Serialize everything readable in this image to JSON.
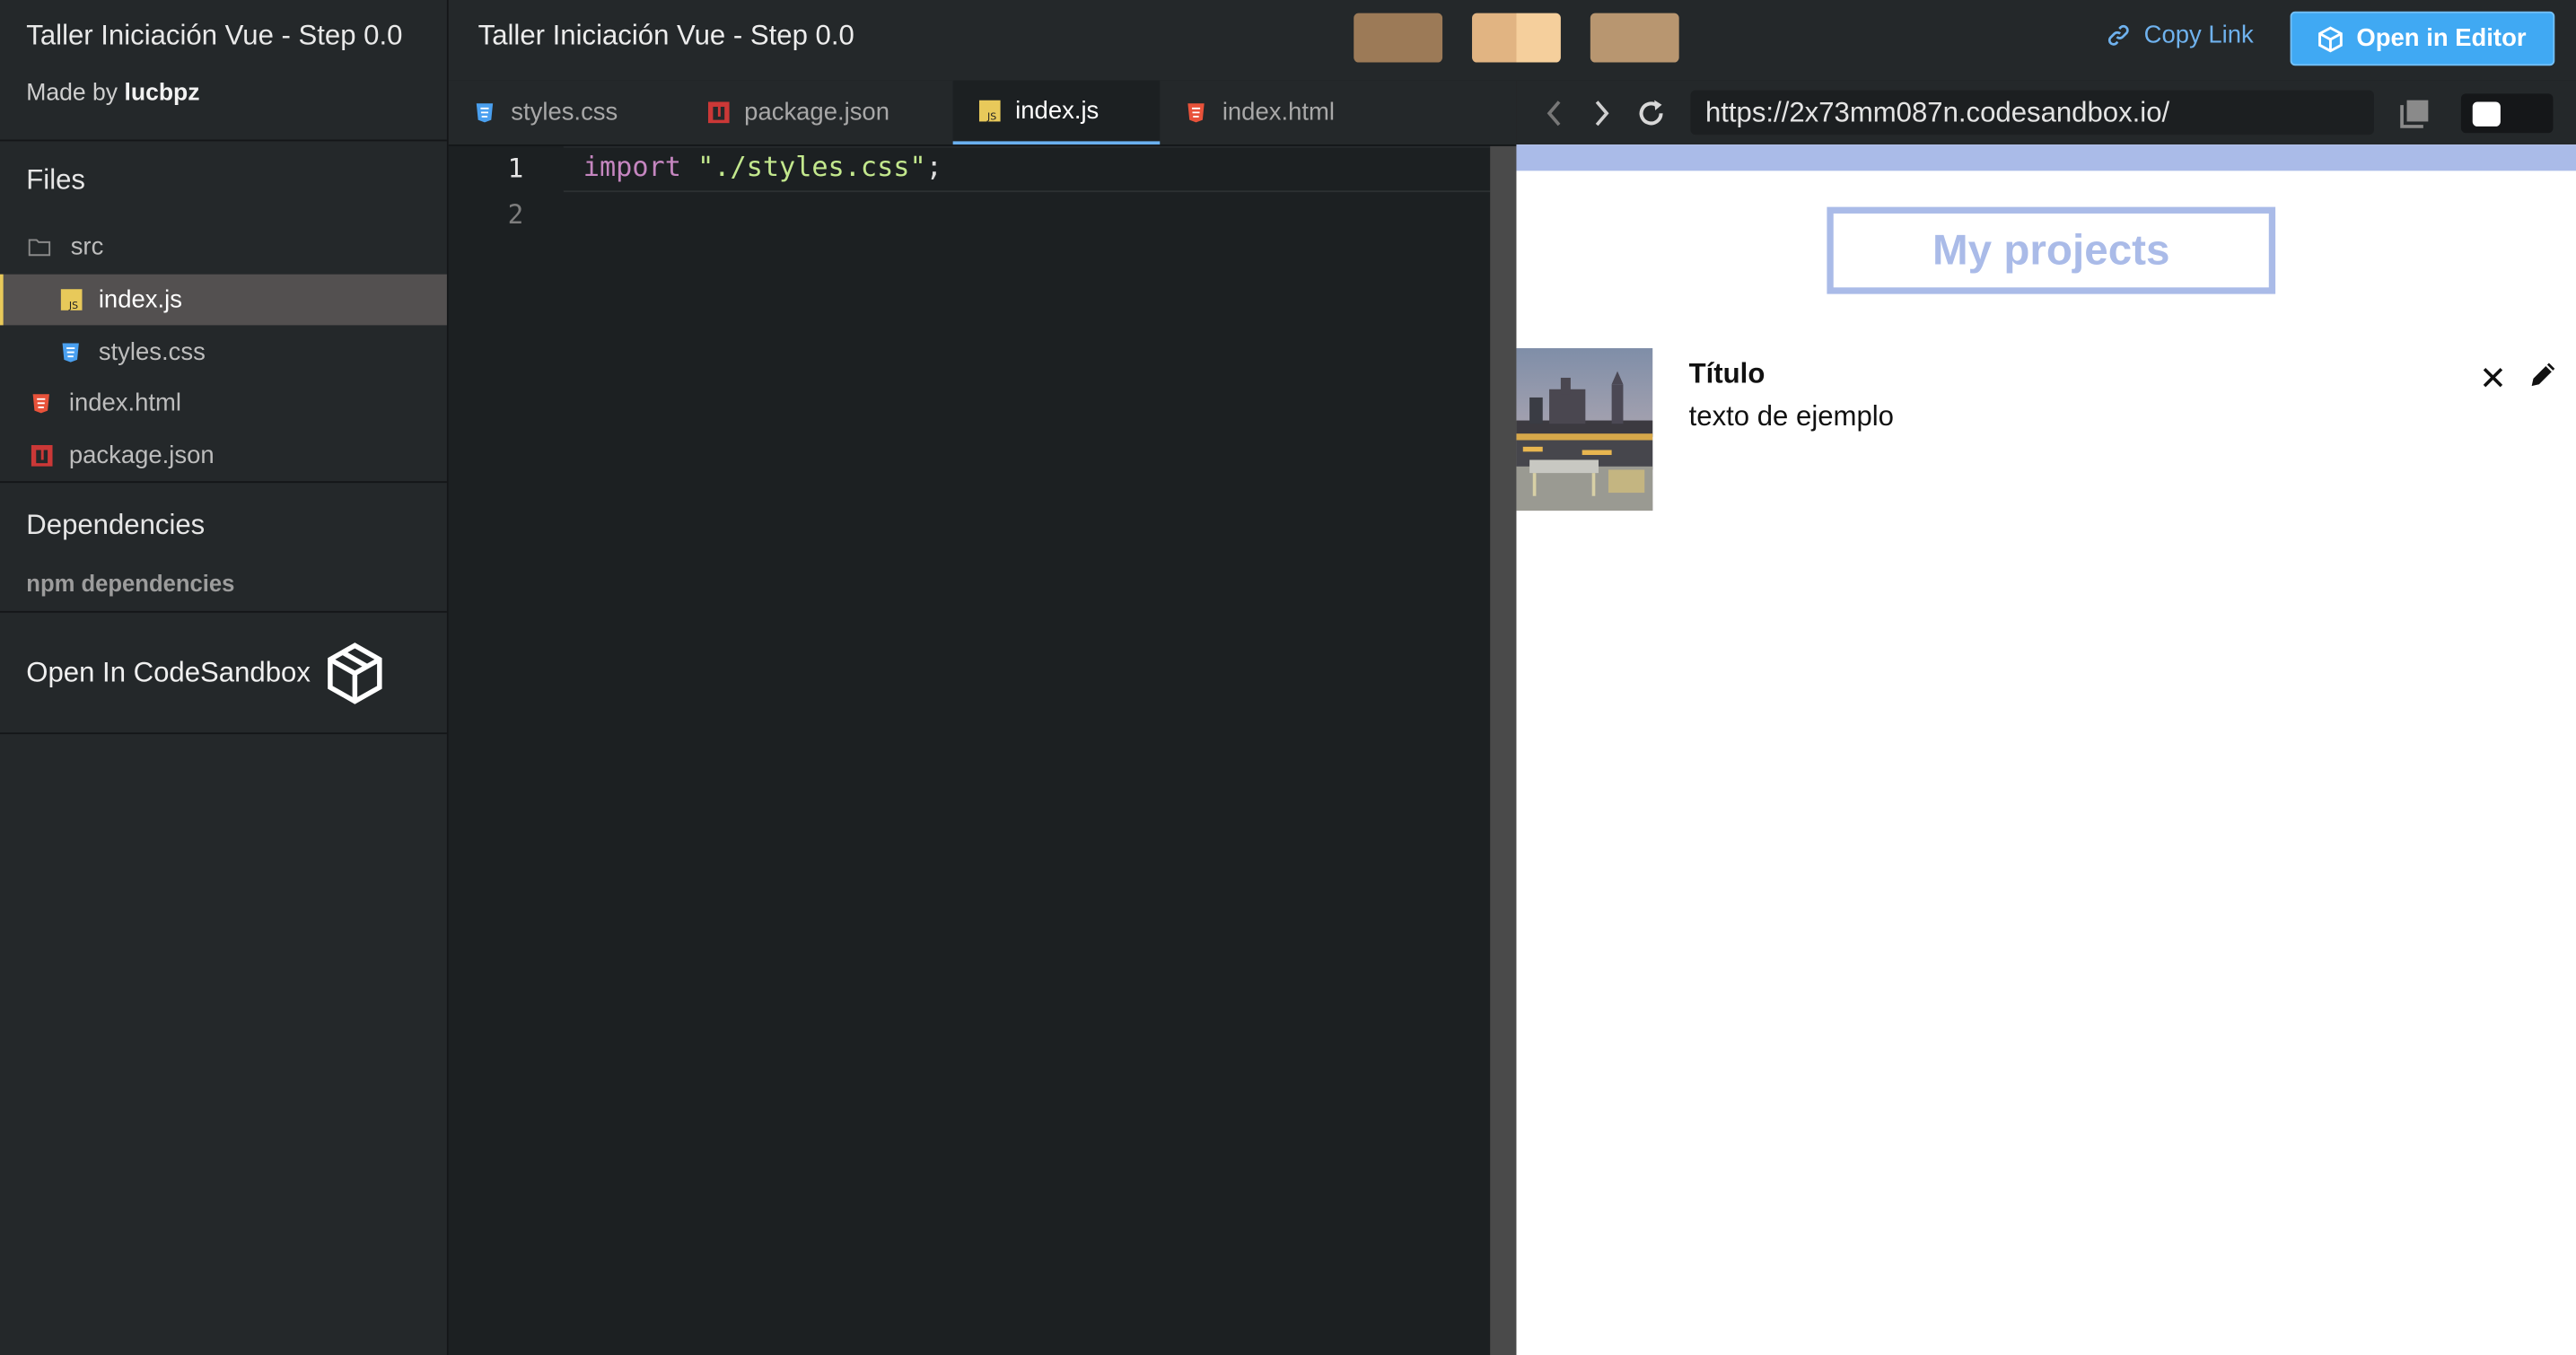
{
  "sidebar": {
    "title": "Taller Iniciación Vue - Step 0.0",
    "made_by_prefix": "Made by",
    "made_by_user": "lucbpz",
    "files_heading": "Files",
    "files": [
      {
        "label": "src",
        "type": "folder"
      },
      {
        "label": "index.js",
        "type": "js",
        "active": true
      },
      {
        "label": "styles.css",
        "type": "css"
      },
      {
        "label": "index.html",
        "type": "html"
      },
      {
        "label": "package.json",
        "type": "npm"
      }
    ],
    "dependencies_heading": "Dependencies",
    "npm_dependencies": "npm dependencies",
    "open_in": "Open In CodeSandbox"
  },
  "header": {
    "title": "Taller Iniciación Vue - Step 0.0",
    "copy_link": "Copy Link",
    "open_in_editor": "Open in Editor"
  },
  "tabs": [
    {
      "label": "styles.css",
      "icon": "css-icon"
    },
    {
      "label": "package.json",
      "icon": "npm-icon"
    },
    {
      "label": "index.js",
      "icon": "js-icon",
      "active": true
    },
    {
      "label": "index.html",
      "icon": "html-icon"
    }
  ],
  "editor": {
    "line_numbers": [
      "1",
      "2"
    ],
    "line1": {
      "keyword": "import",
      "string": "\"./styles.css\"",
      "punct": ";"
    }
  },
  "preview": {
    "url": "https://2x73mm087n.codesandbox.io/",
    "heading": "My projects",
    "card_title": "Título",
    "card_text": "texto de ejemplo",
    "close_glyph": "✕"
  },
  "colors": {
    "accent_blue": "#40a9f3",
    "link_blue": "#6fb2ee",
    "preview_accent": "#aabbe8",
    "active_file_marker": "#e8c95a"
  }
}
